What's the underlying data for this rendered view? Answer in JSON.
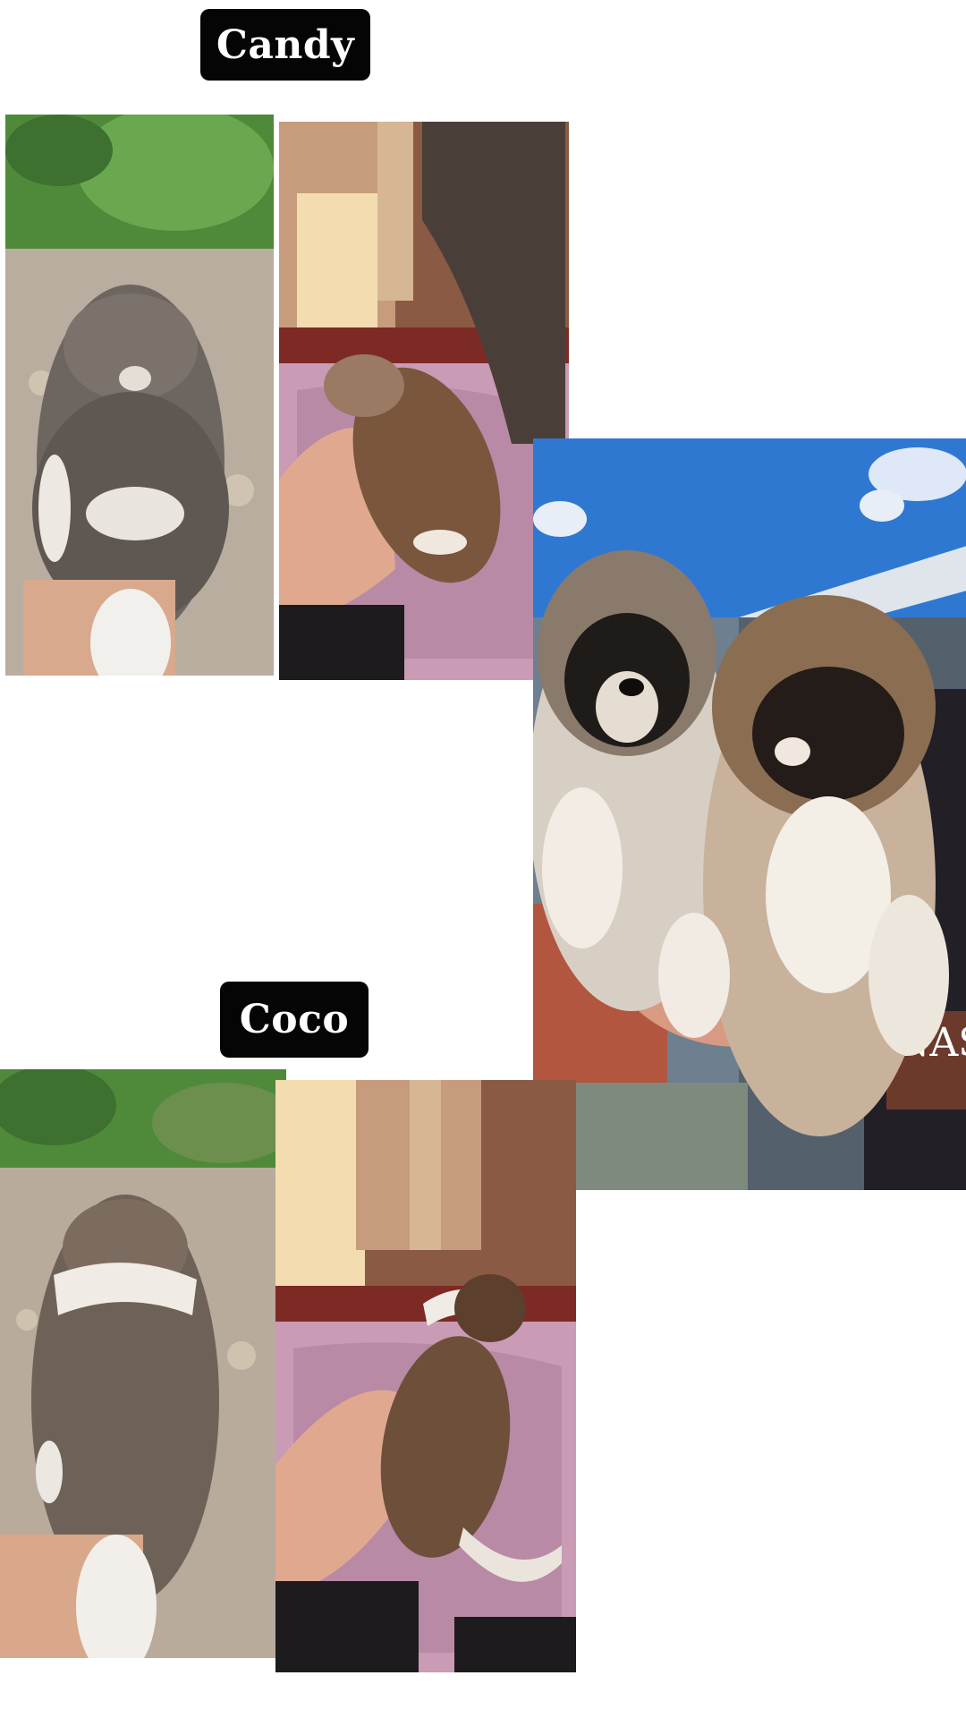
{
  "collage": {
    "labels": [
      {
        "text": "Candy"
      },
      {
        "text": "Coco"
      }
    ],
    "photos": [
      {
        "subject": "puppy-candy-back-view-on-ground"
      },
      {
        "subject": "puppy-candy-held-in-hand-on-pink-blanket"
      },
      {
        "subject": "two-puppies-held-up-against-blue-sky"
      },
      {
        "subject": "puppy-coco-back-view-on-ground"
      },
      {
        "subject": "puppy-coco-held-in-hand-on-pink-blanket"
      }
    ],
    "shirt_text": "NAS"
  }
}
